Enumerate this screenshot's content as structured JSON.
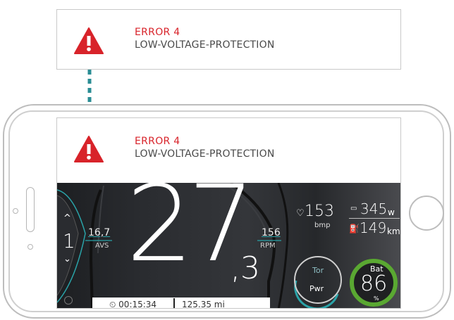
{
  "notification": {
    "title": "ERROR 4",
    "message": "LOW-VOLTAGE-PROTECTION",
    "icon": "warning-icon"
  },
  "dashboard": {
    "gear": {
      "up_icon": "^",
      "value": "1",
      "down_icon": "⌄"
    },
    "avs": {
      "value": "16,7",
      "label": "AVS"
    },
    "speed": {
      "main": "27",
      "decimal": ",3"
    },
    "rpm": {
      "value": "156",
      "label": "RPM"
    },
    "heart_rate": {
      "icon": "♡",
      "value": "153",
      "unit": "bmp"
    },
    "power": {
      "icon": "▭",
      "value": "345",
      "unit": "w"
    },
    "range": {
      "icon": "⛽",
      "value": "149",
      "unit": "km"
    },
    "mode_dial": {
      "top": "Tor",
      "bottom": "Pwr"
    },
    "battery": {
      "label": "Bat",
      "value": "86",
      "unit": "%",
      "level": 0.86
    },
    "timer": "⏲ 00:15:34",
    "distance": "125.35 mi"
  },
  "colors": {
    "error": "#d8232a",
    "teal": "#2a8d94",
    "battery": "#5aa832"
  }
}
